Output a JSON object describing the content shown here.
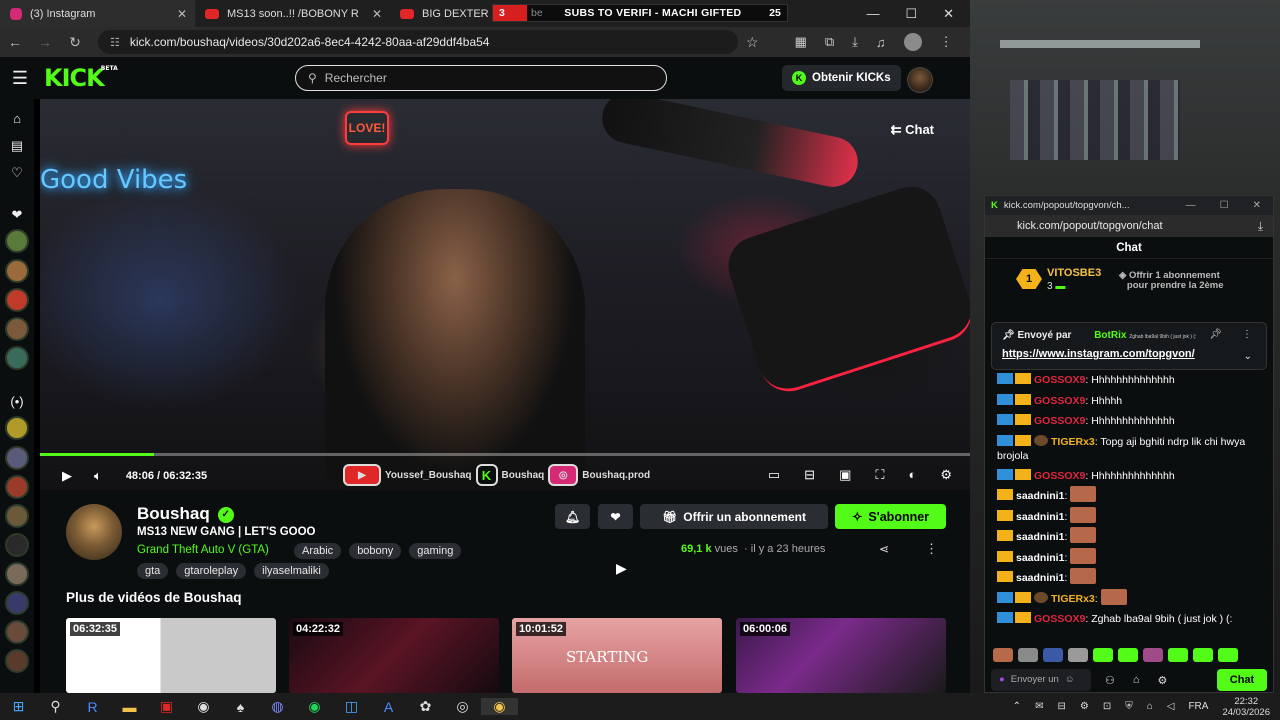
{
  "browser": {
    "tabs": [
      {
        "label": "(3) Instagram",
        "color": "#d62976"
      },
      {
        "label": "MS13 soon..!! /BOBONY R",
        "color": "#e02626"
      },
      {
        "label": "BIG DEXTER",
        "color": "#e02626"
      }
    ],
    "overlay": {
      "count": "3",
      "tag": "be",
      "text": "SUBS TO VERIFI - MACHI GIFTED",
      "number": "25"
    },
    "url": "kick.com/boushaq/videos/30d202a6-8ec4-4242-80aa-af29ddf4ba54"
  },
  "header": {
    "logo": "KICK",
    "logo_badge": "BETA",
    "search_placeholder": "Rechercher",
    "get_kicks": "Obtenir KICKs"
  },
  "video": {
    "neon_text": "Good Vibes",
    "neon_sign": "LOVE!",
    "chat_toggle": "Chat",
    "time": "48:06 / 06:32:35",
    "progress": 0.123,
    "socials": [
      {
        "label": "Youssef_Boushaq",
        "icon": "youtube-icon",
        "color": "#e02626"
      },
      {
        "label": "Boushaq",
        "icon": "kick-icon",
        "color": "#53fc18"
      },
      {
        "label": "Boushaq.prod",
        "icon": "instagram-icon",
        "color": "#d62976"
      }
    ]
  },
  "channel": {
    "name": "Boushaq",
    "title": "MS13 NEW GANG | LET'S GOOO",
    "category": "Grand Theft Auto V (GTA)",
    "tags_row1": [
      "Arabic",
      "bobony",
      "gaming"
    ],
    "tags_row2": [
      "gta",
      "gtaroleplay",
      "ilyaselmaliki"
    ],
    "subscribe_offer": "Offrir un abonnement",
    "follow": "S'abonner",
    "views_count": "69,1 k",
    "views_label": "vues",
    "ago": "il y a 23 heures",
    "more_title": "Plus de vidéos de Boushaq",
    "thumbs": [
      {
        "duration": "06:32:35",
        "text": ""
      },
      {
        "duration": "04:22:32",
        "text": ""
      },
      {
        "duration": "10:01:52",
        "text": "STARTING"
      },
      {
        "duration": "06:00:06",
        "text": ""
      }
    ]
  },
  "chat_window": {
    "title": "kick.com/popout/topgvon/ch...",
    "url": "kick.com/popout/topgvon/chat",
    "heading": "Chat",
    "gifter": {
      "rank": "1",
      "name": "VITOSBE3",
      "count": "3",
      "offer_line1": "Offrir 1 abonnement",
      "offer_line2": "pour prendre la 2ème"
    },
    "pinned": {
      "sent_by": "Envoyé par",
      "bot": "BotRix",
      "preview": "Zghab lba9al 9bih ( just jok ) (:",
      "link": "https://www.instagram.com/topgvon/"
    },
    "messages": [
      {
        "user": "GOSSOX9",
        "color": "#e0263f",
        "text": "Hhhhhhhhhhhhhh",
        "badges": 2,
        "emote": false
      },
      {
        "user": "GOSSOX9",
        "color": "#e0263f",
        "text": "Hhhhh",
        "badges": 2,
        "emote": false
      },
      {
        "user": "GOSSOX9",
        "color": "#e0263f",
        "text": "Hhhhhhhhhhhhhh",
        "badges": 2,
        "emote": false
      },
      {
        "user": "TIGERx3",
        "color": "#f3b21a",
        "text": "Topg aji bghiti ndrp lik chi hwya brojola",
        "badges": 3,
        "emote": false
      },
      {
        "user": "GOSSOX9",
        "color": "#e0263f",
        "text": "Hhhhhhhhhhhhhh",
        "badges": 2,
        "emote": false
      },
      {
        "user": "saadnini1",
        "color": "#ffffff",
        "text": "",
        "badges": 1,
        "emote": true
      },
      {
        "user": "saadnini1",
        "color": "#ffffff",
        "text": "",
        "badges": 1,
        "emote": true
      },
      {
        "user": "saadnini1",
        "color": "#ffffff",
        "text": "",
        "badges": 1,
        "emote": true
      },
      {
        "user": "saadnini1",
        "color": "#ffffff",
        "text": "",
        "badges": 1,
        "emote": true
      },
      {
        "user": "saadnini1",
        "color": "#ffffff",
        "text": "",
        "badges": 1,
        "emote": true
      },
      {
        "user": "TIGERx3",
        "color": "#f3b21a",
        "text": "",
        "badges": 3,
        "emote": true
      },
      {
        "user": "GOSSOX9",
        "color": "#e0263f",
        "text": "Zghab lba9al 9bih ( just jok ) (:",
        "badges": 2,
        "emote": false
      }
    ],
    "input_placeholder": "Envoyer un",
    "send": "Chat"
  },
  "taskbar": {
    "lang": "FRA",
    "time": "22:32",
    "date": "24/03/2026"
  },
  "colors": {
    "kick_green": "#53fc18",
    "bg": "#0b0e0f"
  }
}
